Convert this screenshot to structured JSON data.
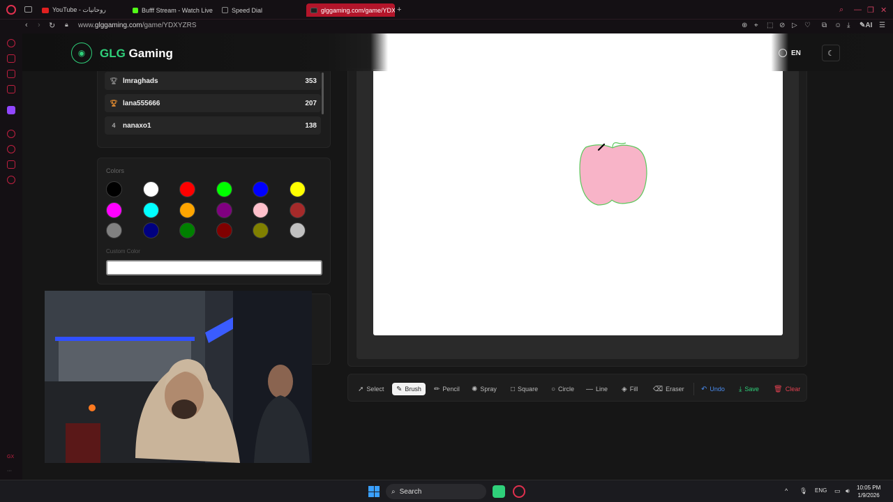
{
  "browser": {
    "tabs": [
      {
        "label": "YouTube - روحانيات",
        "favicon_color": "#e02020"
      },
      {
        "label": "Bufff Stream - Watch Live",
        "favicon_color": "#53fc18"
      },
      {
        "label": "Speed Dial",
        "favicon_color": "#888888"
      },
      {
        "label": "glggaming.com/game/YDXYZRS",
        "favicon_color": "#222222",
        "active": true
      }
    ],
    "new_tab": "+",
    "url_prefix": "www.",
    "url_host": "glggaming.com",
    "url_path": "/game/YDXYZRS",
    "ai_label": "AI",
    "accent": "#b3152a"
  },
  "site": {
    "brand_accent": "GLG",
    "brand_rest": " Gaming",
    "language": "EN"
  },
  "leaderboard": {
    "rows": [
      {
        "rank": "",
        "name": "lmraghads",
        "score": "353"
      },
      {
        "rank": "",
        "name": "lana555666",
        "score": "207"
      },
      {
        "rank": "4",
        "name": "nanaxo1",
        "score": "138"
      }
    ]
  },
  "colors_panel": {
    "title": "Colors",
    "swatches": [
      "#000000",
      "#ffffff",
      "#ff0000",
      "#00ff00",
      "#0000ff",
      "#ffff00",
      "#ff00ff",
      "#00ffff",
      "#ffa500",
      "#800080",
      "#ffc0cb",
      "#a52a2a",
      "#808080",
      "#000080",
      "#008000",
      "#800000",
      "#808000",
      "#c0c0c0"
    ],
    "custom_label": "Custom Color",
    "custom_value": "#ffffff"
  },
  "drawing": {
    "fill_color": "#f8b4c8",
    "stroke_color": "#5cc85c"
  },
  "toolbar": {
    "tools": [
      {
        "label": "Select",
        "icon": "cursor-icon"
      },
      {
        "label": "Brush",
        "icon": "brush-icon",
        "active": true
      },
      {
        "label": "Pencil",
        "icon": "pencil-icon"
      },
      {
        "label": "Spray",
        "icon": "spray-icon"
      },
      {
        "label": "Square",
        "icon": "square-icon"
      },
      {
        "label": "Circle",
        "icon": "circle-icon"
      },
      {
        "label": "Line",
        "icon": "line-icon"
      },
      {
        "label": "Fill",
        "icon": "fill-icon"
      },
      {
        "label": "Eraser",
        "icon": "eraser-icon"
      }
    ],
    "undo": "Undo",
    "save": "Save",
    "clear": "Clear"
  },
  "sidebar": {
    "gx_label": "GX",
    "more_label": "···"
  },
  "taskbar": {
    "search_placeholder": "Search",
    "language": "ENG",
    "time": "10:05 PM",
    "date": "1/9/2026"
  }
}
